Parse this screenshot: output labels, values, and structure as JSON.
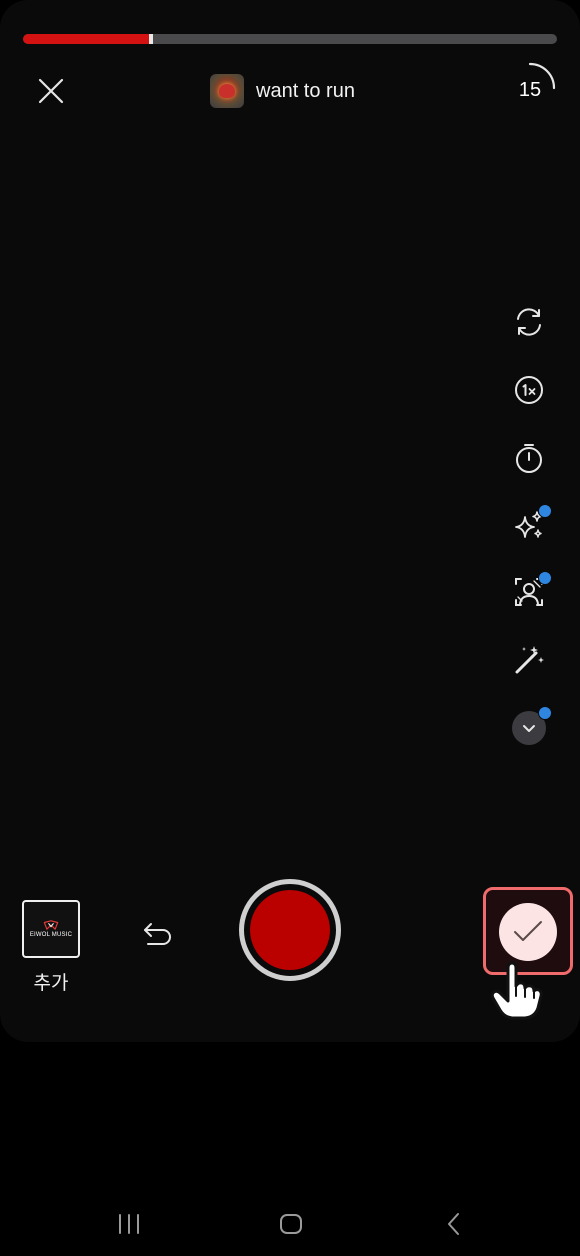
{
  "progress": {
    "value": 0.24,
    "marker": 0.24
  },
  "top_bar": {
    "close_icon": "close-icon",
    "music_title": "want to run",
    "duration_label": "15"
  },
  "tools": [
    {
      "name": "flip-camera-icon",
      "badge": false
    },
    {
      "name": "speed-1x-icon",
      "badge": false
    },
    {
      "name": "timer-icon",
      "badge": false
    },
    {
      "name": "sparkle-effects-icon",
      "badge": true
    },
    {
      "name": "portrait-filter-icon",
      "badge": true
    },
    {
      "name": "magic-wand-icon",
      "badge": false
    },
    {
      "name": "more-chevron-icon",
      "badge": true
    }
  ],
  "bottom": {
    "add_thumb_logo": "EIWOL MUSIC",
    "add_label": "추가",
    "undo_icon": "undo-icon",
    "record_icon": "record-icon",
    "confirm_icon": "check-icon"
  },
  "colors": {
    "accent_red": "#d51212",
    "record_red": "#bb0000",
    "badge_blue": "#2f86e0",
    "highlight": "#f06b6b"
  },
  "nav": [
    "recent-apps-icon",
    "home-icon",
    "back-icon"
  ]
}
